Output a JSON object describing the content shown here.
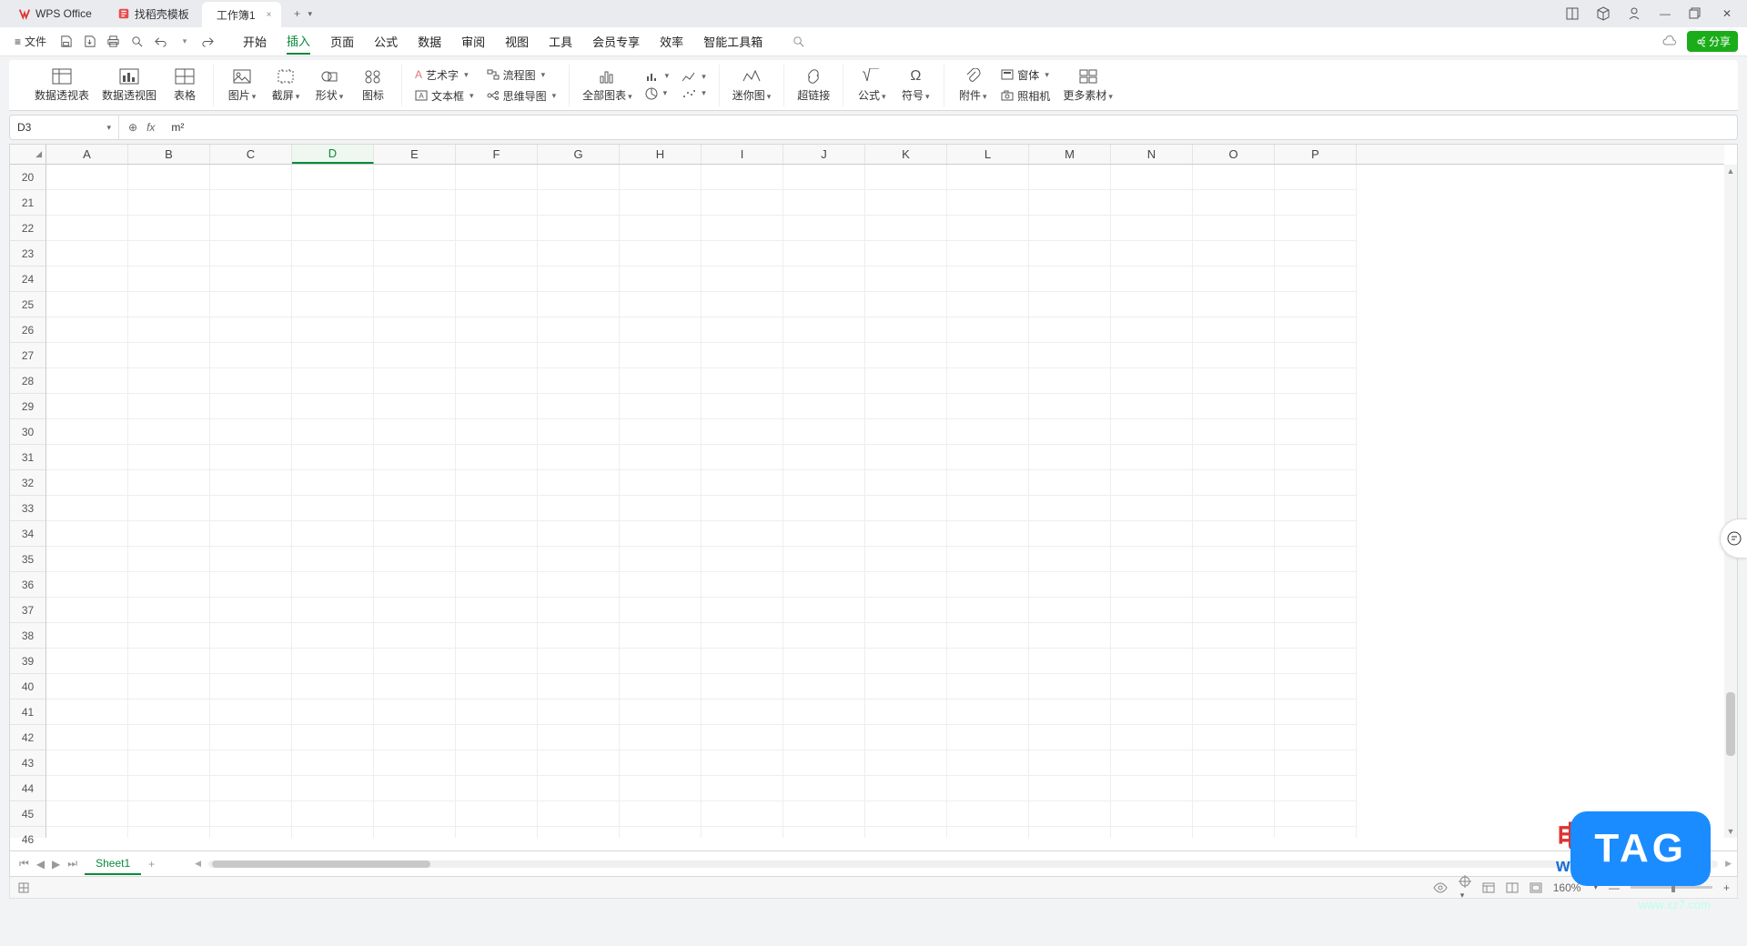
{
  "title_bar": {
    "app_name": "WPS Office",
    "template_tab": "找稻壳模板",
    "doc_tab": "工作簿1",
    "close_glyph": "×",
    "add_glyph": "+",
    "drop_glyph": "▾"
  },
  "win_icons": [
    "layout-icon",
    "cube-icon",
    "user-icon",
    "minimize-icon",
    "restore-icon",
    "close-icon"
  ],
  "menu": {
    "file_icon": "≡",
    "file_label": "文件",
    "qat_icons": [
      "save-icon",
      "saveas-icon",
      "print-icon",
      "preview-icon",
      "undo-icon",
      "undo-drop",
      "redo-icon"
    ],
    "tabs": [
      "开始",
      "插入",
      "页面",
      "公式",
      "数据",
      "审阅",
      "视图",
      "工具",
      "会员专享",
      "效率",
      "智能工具箱"
    ],
    "active_tab_index": 1,
    "search_icon": "search-icon",
    "cloud_icon": "cloud-icon",
    "share_label": "分享"
  },
  "ribbon": {
    "g1": {
      "pivot_table": "数据透视表",
      "pivot_chart": "数据透视图",
      "table": "表格"
    },
    "g2": {
      "picture": "图片",
      "screenshot": "截屏",
      "shape": "形状",
      "icon": "图标"
    },
    "g3": {
      "wordart": "艺术字",
      "flowchart": "流程图",
      "textbox": "文本框",
      "mindmap": "思维导图"
    },
    "g4": {
      "allcharts": "全部图表"
    },
    "g5": {
      "sparkline": "迷你图"
    },
    "g6": {
      "hyperlink": "超链接"
    },
    "g7": {
      "equation": "公式",
      "symbol": "符号"
    },
    "g8": {
      "attachment": "附件",
      "object": "窗体",
      "camera": "照相机",
      "more": "更多素材"
    }
  },
  "formula_bar": {
    "name_box": "D3",
    "fx_label": "fx",
    "zoom_icon": "⊕",
    "value": "m²"
  },
  "sheet": {
    "columns": [
      "A",
      "B",
      "C",
      "D",
      "E",
      "F",
      "G",
      "H",
      "I",
      "J",
      "K",
      "L",
      "M",
      "N",
      "O",
      "P"
    ],
    "selected_col_index": 3,
    "row_start": 20,
    "row_end": 46,
    "last_partial_row": "46",
    "active_cell": "D3"
  },
  "sheet_tabs": {
    "nav": [
      "⏮",
      "◀",
      "▶",
      "⏭"
    ],
    "sheet1": "Sheet1",
    "add": "+"
  },
  "status": {
    "left_icon": "assist-icon",
    "view_icons": [
      "eye-icon",
      "target-icon",
      "normal-view-icon",
      "page-view-icon",
      "custom-view-icon"
    ],
    "zoom_label": "160%"
  },
  "watermarks": {
    "line1": "电脑技术网",
    "line2": "www.tagxp.com",
    "tag": "TAG",
    "small": "www.xz7.com"
  }
}
